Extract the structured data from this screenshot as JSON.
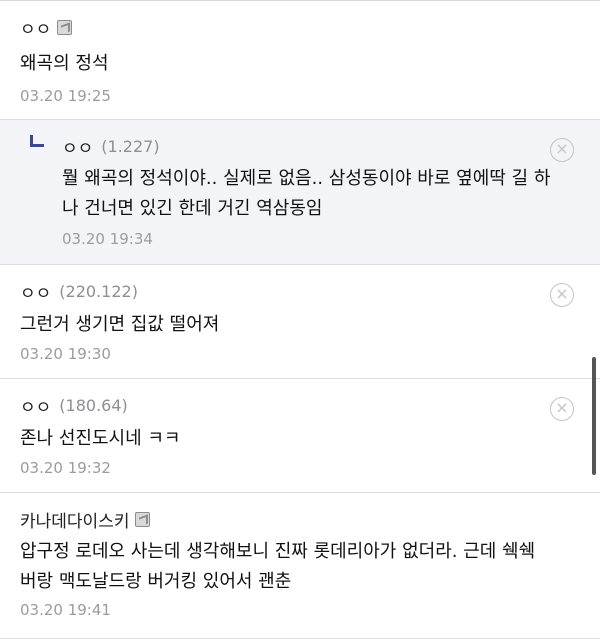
{
  "comments": [
    {
      "author": "ㅇㅇ",
      "ip": "",
      "body": "왜곡의 정석",
      "time": "03.20 19:25"
    },
    {
      "author": "ㅇㅇ",
      "ip": "(1.227)",
      "body_line1": "뭘 왜곡의 정석이야.. 실제로 없음.. 삼성동이야 바로 옆에딱 길 하",
      "body_line2": "나 건너면 있긴 한데 거긴 역삼동임",
      "time": "03.20 19:34",
      "delete_icon": "×"
    },
    {
      "author": "ㅇㅇ",
      "ip": "(220.122)",
      "body": "그런거 생기면 집값 떨어져",
      "time": "03.20 19:30",
      "delete_icon": "×"
    },
    {
      "author": "ㅇㅇ",
      "ip": "(180.64)",
      "body": "존나 선진도시네 ㅋㅋ",
      "time": "03.20 19:32",
      "delete_icon": "×"
    },
    {
      "author": "카나데다이스키",
      "ip": "",
      "body_line1": "압구정 로데오 사는데 생각해보니 진짜 롯데리아가 없더라. 근데 쉑쉑",
      "body_line2": "버랑 맥도날드랑 버거킹 있어서 괜춘",
      "time": "03.20 19:41"
    }
  ]
}
